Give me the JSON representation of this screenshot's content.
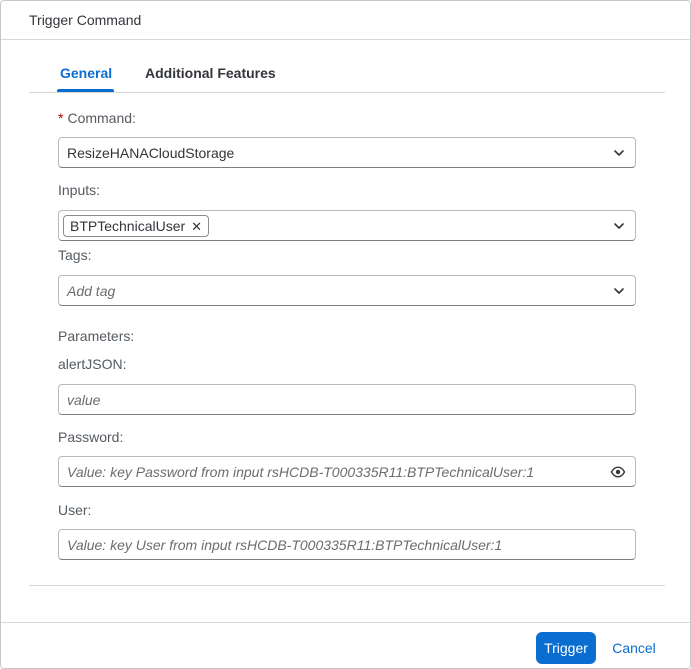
{
  "dialog": {
    "title": "Trigger Command"
  },
  "tabs": [
    {
      "label": "General",
      "selected": true
    },
    {
      "label": "Additional Features",
      "selected": false
    }
  ],
  "command": {
    "required_mark": "*",
    "label": "Command:",
    "value": "ResizeHANACloudStorage"
  },
  "inputs": {
    "label": "Inputs:",
    "tokens": [
      "BTPTechnicalUser"
    ]
  },
  "tags": {
    "label": "Tags:",
    "placeholder": "Add tag"
  },
  "parameters": {
    "label": "Parameters:",
    "alert_json": {
      "label": "alertJSON:",
      "placeholder": "value"
    },
    "password": {
      "label": "Password:",
      "placeholder": "Value: key Password from input rsHCDB-T000335R11:BTPTechnicalUser:1"
    },
    "user": {
      "label": "User:",
      "placeholder": "Value: key User from input rsHCDB-T000335R11:BTPTechnicalUser:1"
    }
  },
  "footer": {
    "trigger_label": "Trigger",
    "cancel_label": "Cancel"
  },
  "icons": {
    "dropdown": "chevron-down-icon",
    "token_remove": "close-icon",
    "show_password": "eye-icon"
  },
  "colors": {
    "accent": "#0a6ed1",
    "required": "#bb0000"
  }
}
